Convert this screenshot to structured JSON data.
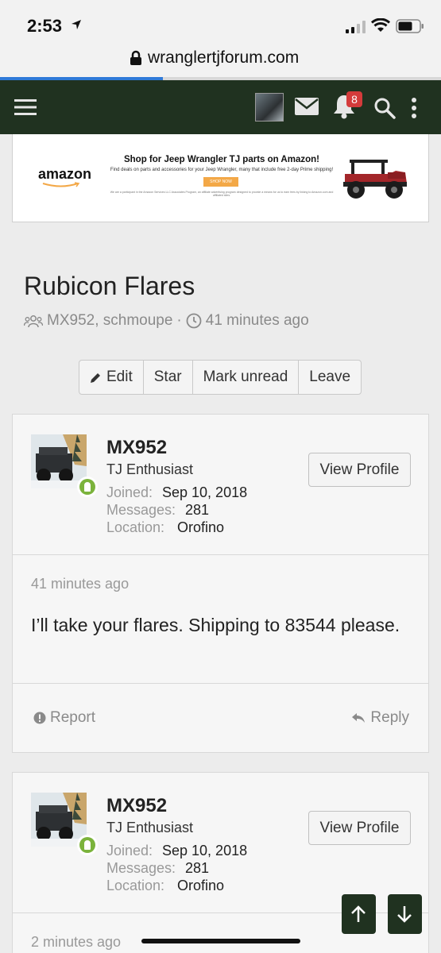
{
  "status_bar": {
    "time": "2:53"
  },
  "browser": {
    "url": "wranglertjforum.com",
    "load_progress_percent": 37
  },
  "nav": {
    "notification_count": "8"
  },
  "ad": {
    "brand": "amazon",
    "headline": "Shop for Jeep Wrangler TJ parts on Amazon!",
    "subline": "Find deals on parts and accessories for your Jeep Wrangler, many that include free 2-day Prime shipping!",
    "button": "SHOP NOW",
    "fine_print": "We are a participant in the Amazon Services LLC Associates Program, an affiliate advertising program designed to provide a means for us to earn fees by linking to Amazon.com and affiliated sites."
  },
  "thread": {
    "title": "Rubicon Flares",
    "participants": "MX952, schmoupe",
    "separator": "·",
    "age": "41 minutes ago",
    "actions": [
      "Edit",
      "Star",
      "Mark unread",
      "Leave"
    ]
  },
  "posts": [
    {
      "username": "MX952",
      "user_title": "TJ Enthusiast",
      "joined_label": "Joined:",
      "joined": "Sep 10, 2018",
      "messages_label": "Messages:",
      "messages": "281",
      "location_label": "Location:",
      "location": "Orofino",
      "view_profile": "View Profile",
      "time": "41 minutes ago",
      "body": "I’ll take your flares. Shipping to 83544 please.",
      "report": "Report",
      "reply": "Reply"
    },
    {
      "username": "MX952",
      "user_title": "TJ Enthusiast",
      "joined_label": "Joined:",
      "joined": "Sep 10, 2018",
      "messages_label": "Messages:",
      "messages": "281",
      "location_label": "Location:",
      "location": "Orofino",
      "view_profile": "View Profile",
      "time": "2 minutes ago"
    }
  ],
  "colors": {
    "nav_bg": "#203220",
    "badge": "#d43b3b",
    "online": "#7bb33c",
    "progress": "#2f7ad8"
  }
}
